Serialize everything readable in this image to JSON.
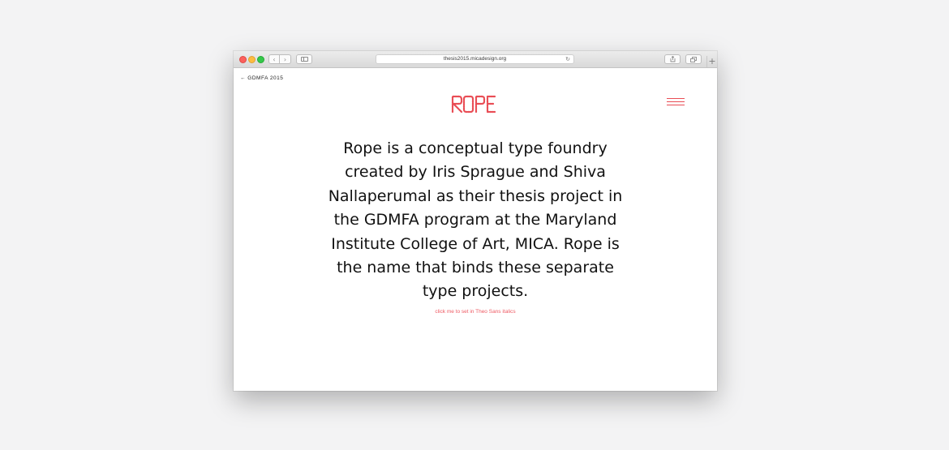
{
  "browser": {
    "url": "thesis2015.micadesign.org",
    "back_icon": "chevron-left-icon",
    "forward_icon": "chevron-right-icon",
    "sidebar_icon": "sidebar-icon",
    "reload_icon": "reload-icon",
    "share_icon": "share-icon",
    "tabs_icon": "tabs-icon",
    "new_tab_label": "+"
  },
  "page": {
    "back_link": "← GDMFA 2015",
    "logo_text": "ROPE",
    "logo_color": "#e94d55",
    "menu_icon": "hamburger-menu-icon",
    "intro": "Rope is a conceptual type foundry created by Iris Sprague and Shiva Nallaperumal as their thesis project in the GDMFA program at the Maryland Institute College of Art, MICA. Rope is the name that binds these separate type projects.",
    "toggle_link": "click me to set in Theo Sans italics",
    "accent_color": "#ee5a63"
  }
}
